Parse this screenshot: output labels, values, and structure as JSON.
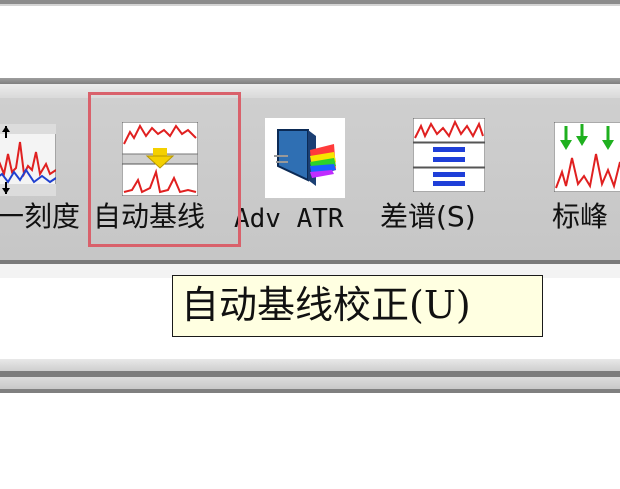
{
  "toolbar": {
    "buttons": [
      {
        "id": "scale",
        "label": "一刻度",
        "icon": "spectrum-scale-icon"
      },
      {
        "id": "auto-baseline",
        "label": "自动基线",
        "icon": "baseline-correction-icon",
        "highlighted": true
      },
      {
        "id": "adv-atr",
        "label": "Adv ATR",
        "icon": "atr-prism-icon"
      },
      {
        "id": "difference",
        "label": "差谱(S)",
        "icon": "difference-spectrum-icon"
      },
      {
        "id": "label-peaks",
        "label": "标峰",
        "icon": "peak-label-icon"
      }
    ]
  },
  "tooltip": {
    "text": "自动基线校正(U)"
  },
  "colors": {
    "highlight": "#d9616b",
    "tooltip_bg": "#ffffe1",
    "spectrum": "#e02020"
  }
}
